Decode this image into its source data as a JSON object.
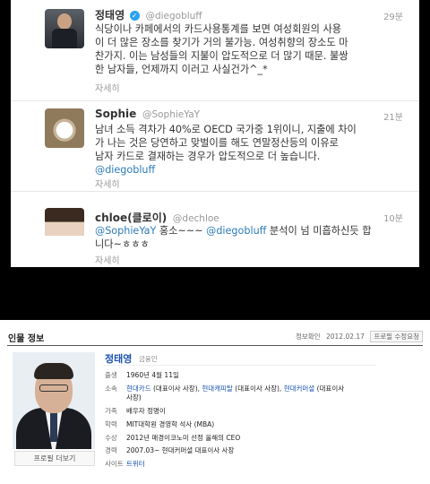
{
  "twitter": {
    "tweets": [
      {
        "name": "정태영",
        "verified": true,
        "handle": "@diegobluff",
        "time": "29분",
        "lines": [
          "식당이나 카페에서의 카드사용통계를 보면 여성회원의 사용",
          "이 더 많은 장소를 찾기가 거의 불가능. 여성취향의 장소도 마",
          "찬가지. 이는 남성들의 지불이 압도적으로 더 많기 때문. 불쌍",
          "한 남자들, 언제까지 이러고 사실건가^_*"
        ],
        "detail": "자세히"
      },
      {
        "name": "Sophie",
        "verified": false,
        "handle": "@SophieYaY",
        "time": "21분",
        "lines": [
          "남녀 소득 격차가 40%로 OECD 국가중 1위이니, 지출에 차이",
          "가 나는 것은 당연하고 맞벌이를 해도 연말정산등의 이유로",
          "남자 카드로 결재하는 경우가 압도적으로 더 높습니다."
        ],
        "mention_line": "@diegobluff",
        "detail": "자세히"
      },
      {
        "name": "chloe(클로이)",
        "verified": false,
        "handle": "@dechloe",
        "time": "10분",
        "mention1": "@SophieYaY",
        "text1": " 홍소~~~ ",
        "mention2": "@diegobluff",
        "text2": " 분석이 넘 미흡하신듯 합",
        "line2": "니다~ㅎㅎㅎ",
        "detail": "자세히"
      }
    ]
  },
  "profile": {
    "section_title": "인물 정보",
    "links": [
      "정보확인",
      "2012.02.17",
      "프로필 수정요청"
    ],
    "name": "정태영",
    "job": "금융인",
    "photo_button": "프로필 더보기",
    "rows": [
      {
        "label": "출생",
        "value": "1960년 4월 11일"
      },
      {
        "label": "소속",
        "value_links": [
          "현대카드",
          "현대캐피탈",
          "현대커머셜"
        ],
        "value_suffixes": [
          " (대표이사 사장), ",
          " (대표이사 사장), ",
          " (대표이사"
        ],
        "value_line2": "사장)"
      },
      {
        "label": "가족",
        "value": "배우자 정명이"
      },
      {
        "label": "학력",
        "value": "MIT대학원 경영학 석사 (MBA)"
      },
      {
        "label": "수상",
        "value": "2012년 매경이코노미 선정 올해의 CEO"
      },
      {
        "label": "경력",
        "value": "2007.03~ 현대커머셜 대표이사 사장"
      },
      {
        "label": "사이트",
        "value_link": "트위터"
      }
    ]
  }
}
